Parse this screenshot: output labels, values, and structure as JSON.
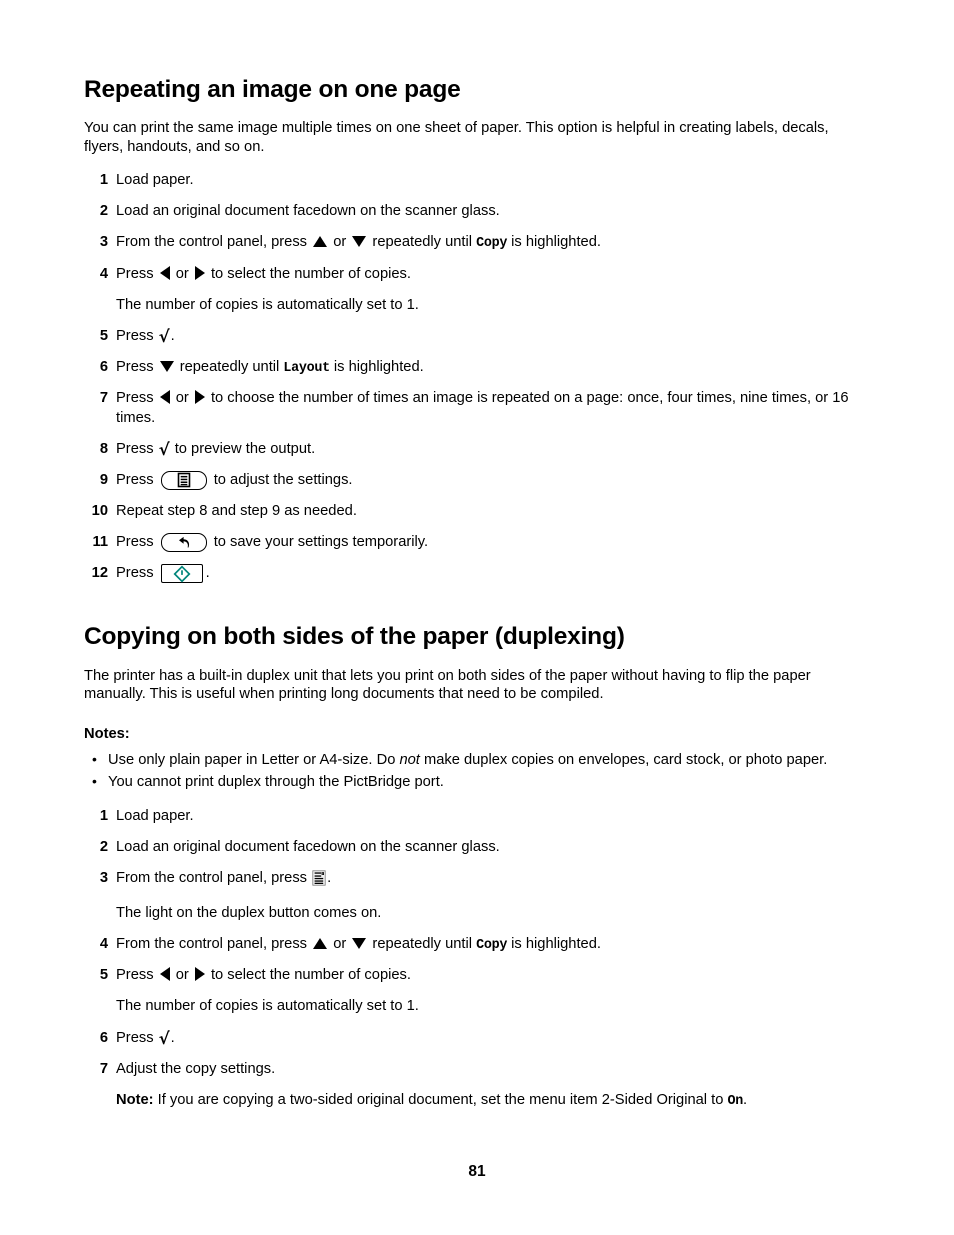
{
  "document": {
    "page_number": "81",
    "accent_color": "#00857a",
    "text_color": "#000000",
    "background_color": "#ffffff"
  },
  "section1": {
    "title": "Repeating an image on one page",
    "intro": "You can print the same image multiple times on one sheet of paper. This option is helpful in creating labels, decals, flyers, handouts, and so on.",
    "steps": [
      {
        "num": "1",
        "text": "Load paper."
      },
      {
        "num": "2",
        "text": "Load an original document facedown on the scanner glass."
      },
      {
        "num": "3",
        "pre": "From the control panel, press ",
        "mid": " or ",
        "post": " repeatedly until ",
        "mono": "Copy",
        "tail": " is highlighted."
      },
      {
        "num": "4",
        "pre": "Press ",
        "mid": " or ",
        "post": " to select the number of copies.",
        "sub": "The number of copies is automatically set to 1."
      },
      {
        "num": "5",
        "pre": "Press ",
        "post": "."
      },
      {
        "num": "6",
        "pre": "Press ",
        "post": " repeatedly until ",
        "mono": "Layout",
        "tail": " is highlighted."
      },
      {
        "num": "7",
        "pre": "Press ",
        "mid": " or ",
        "post": " to choose the number of times an image is repeated on a page: once, four times, nine times, or 16 times."
      },
      {
        "num": "8",
        "pre": "Press ",
        "post": " to preview the output."
      },
      {
        "num": "9",
        "pre": "Press ",
        "post": " to adjust the settings."
      },
      {
        "num": "10",
        "text": "Repeat step 8 and step 9 as needed."
      },
      {
        "num": "11",
        "pre": "Press ",
        "post": " to save your settings temporarily."
      },
      {
        "num": "12",
        "pre": "Press ",
        "post": "."
      }
    ]
  },
  "section2": {
    "title": "Copying on both sides of the paper (duplexing)",
    "intro": "The printer has a built-in duplex unit that lets you print on both sides of the paper without having to flip the paper manually. This is useful when printing long documents that need to be compiled.",
    "notes_label": "Notes:",
    "notes": [
      {
        "pre": "Use only plain paper in Letter or A4-size. Do ",
        "italic": "not",
        "post": " make duplex copies on envelopes, card stock, or photo paper."
      },
      {
        "pre": "You cannot print duplex through the PictBridge port."
      }
    ],
    "steps": [
      {
        "num": "1",
        "text": "Load paper."
      },
      {
        "num": "2",
        "text": "Load an original document facedown on the scanner glass."
      },
      {
        "num": "3",
        "pre": "From the control panel, press ",
        "post": ".",
        "sub": "The light on the duplex button comes on."
      },
      {
        "num": "4",
        "pre": "From the control panel, press ",
        "mid": " or ",
        "post": " repeatedly until ",
        "mono": "Copy",
        "tail": " is highlighted."
      },
      {
        "num": "5",
        "pre": "Press ",
        "mid": " or ",
        "post": " to select the number of copies.",
        "sub": "The number of copies is automatically set to 1."
      },
      {
        "num": "6",
        "pre": "Press ",
        "post": "."
      },
      {
        "num": "7",
        "text": "Adjust the copy settings.",
        "note_label": "Note:",
        "note_pre": " If you are copying a two-sided original document, set the menu item 2-Sided Original to ",
        "note_mono": "On",
        "note_post": "."
      }
    ]
  },
  "icons": {
    "up_arrow": "triangle-up-icon",
    "down_arrow": "triangle-down-icon",
    "left_arrow": "triangle-left-icon",
    "right_arrow": "triangle-right-icon",
    "select": "checkmark-icon",
    "menu": "menu-key-icon",
    "back": "back-arrow-key-icon",
    "start": "start-key-icon",
    "duplex": "duplex-icon"
  }
}
